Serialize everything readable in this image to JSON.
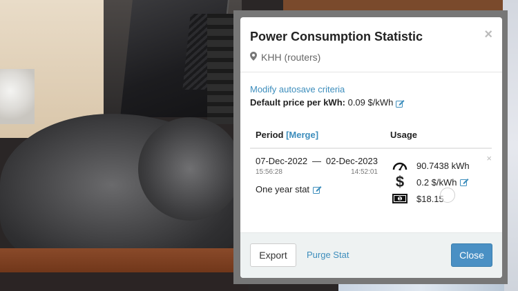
{
  "dialog": {
    "title": "Power Consumption Statistic",
    "device": "KHH (routers)",
    "close_glyph": "×"
  },
  "settings": {
    "modify_link": "Modify autosave criteria",
    "default_price_label": "Default price per kWh:",
    "default_price_value": "0.09 $/kWh"
  },
  "table": {
    "col_period": "Period",
    "merge_link": "[Merge]",
    "col_usage": "Usage"
  },
  "row": {
    "start_date": "07-Dec-2022",
    "separator": "—",
    "end_date": "02-Dec-2023",
    "start_time": "15:56:28",
    "end_time": "14:52:01",
    "name": "One year stat",
    "energy": "90.7438 kWh",
    "price": "0.2 $/kWh",
    "cost": "$18.15",
    "remove_glyph": "×"
  },
  "footer": {
    "export_label": "Export",
    "purge_label": "Purge Stat",
    "close_label": "Close"
  },
  "colors": {
    "link": "#3c8dbc",
    "primary_button": "#4a90c4",
    "footer_bg": "#eef2f2"
  },
  "icons": [
    "map-marker-icon",
    "edit-icon",
    "speedometer-icon",
    "dollar-icon",
    "banknote-icon",
    "close-icon",
    "spinner"
  ]
}
